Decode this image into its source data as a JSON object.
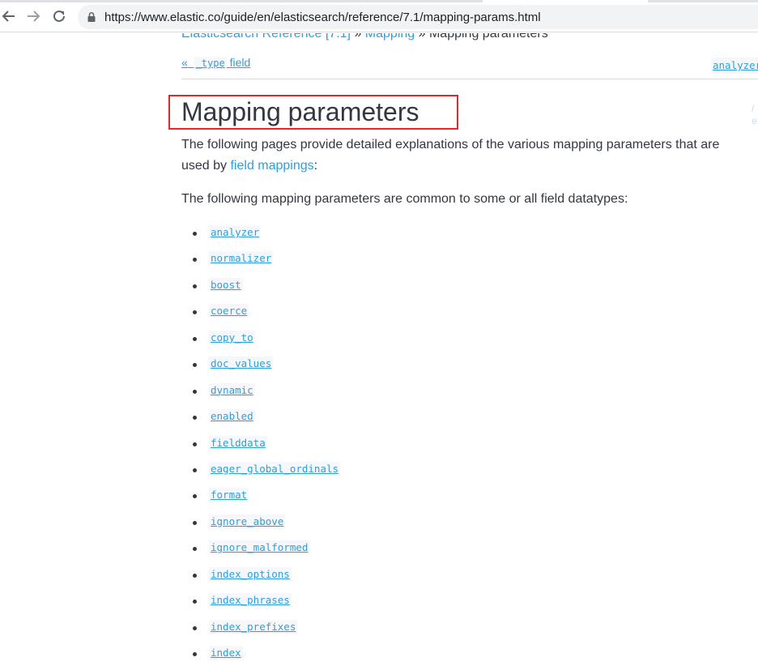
{
  "browser": {
    "url": "https://www.elastic.co/guide/en/elasticsearch/reference/7.1/mapping-params.html",
    "icons": [
      "back-arrow-icon",
      "forward-arrow-icon",
      "reload-icon",
      "lock-icon"
    ]
  },
  "breadcrumb": {
    "root": "Elasticsearch Reference [7.1]",
    "sep1": " » ",
    "section": "Mapping",
    "sep2": " » ",
    "current": "Mapping parameters"
  },
  "page_nav": {
    "prev_arrow": "«",
    "prev_code": "_type",
    "prev_text": "field",
    "next_code": "analyzer"
  },
  "title": "Mapping parameters",
  "intro": {
    "line1": "The following pages provide detailed explanations of the various mapping parameters that are",
    "line2_prefix": "used by ",
    "line2_link": "field mappings",
    "line2_suffix": ":"
  },
  "common_text": "The following mapping parameters are common to some or all field datatypes:",
  "params": [
    "analyzer",
    "normalizer",
    "boost",
    "coerce",
    "copy_to",
    "doc_values",
    "dynamic",
    "enabled",
    "fielddata",
    "eager_global_ordinals",
    "format",
    "ignore_above",
    "ignore_malformed",
    "index_options",
    "index_phrases",
    "index_prefixes",
    "index"
  ],
  "colors": {
    "link": "#2f9fd8",
    "text": "#343741",
    "highlight_box": "#e8262a"
  }
}
